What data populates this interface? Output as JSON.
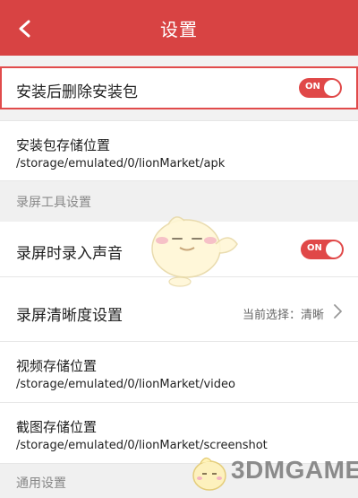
{
  "header": {
    "title": "设置",
    "back_icon": "back-chevron-icon"
  },
  "settings": {
    "delete_after_install": {
      "label": "安装后删除安装包",
      "toggle": "ON"
    },
    "apk_storage": {
      "label": "安装包存储位置",
      "path": "/storage/emulated/0/lionMarket/apk"
    },
    "record_section": "录屏工具设置",
    "record_audio": {
      "label": "录屏时录入声音",
      "toggle": "ON"
    },
    "record_quality": {
      "label": "录屏清晰度设置",
      "current": "当前选择：清晰"
    },
    "video_storage": {
      "label": "视频存储位置",
      "path": "/storage/emulated/0/lionMarket/video"
    },
    "screenshot_storage": {
      "label": "截图存储位置",
      "path": "/storage/emulated/0/lionMarket/screenshot"
    },
    "general_section": "通用设置"
  },
  "watermark": {
    "text": "3DMGAME"
  },
  "colors": {
    "accent": "#d84343",
    "background": "#f2f2f2"
  }
}
